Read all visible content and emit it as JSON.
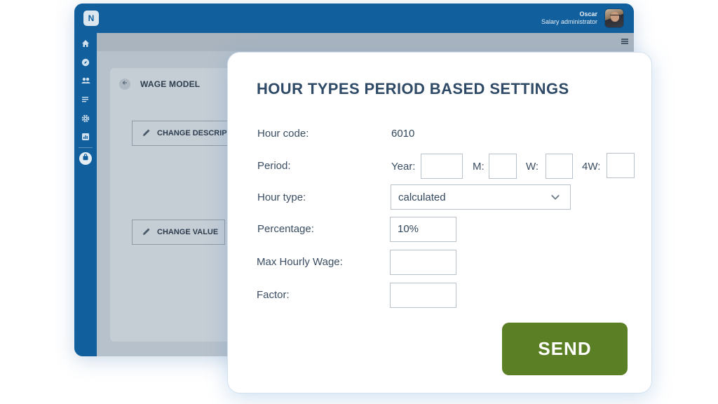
{
  "app": {
    "logo_text": "N",
    "user": {
      "name": "Oscar",
      "role": "Salary administrator"
    },
    "sidebar_icons": [
      "home-icon",
      "compass-icon",
      "users-icon",
      "list-icon",
      "gear-icon",
      "chart-icon",
      "bag-icon"
    ]
  },
  "background_page": {
    "title": "WAGE MODEL",
    "change_description_label": "CHANGE DESCRIPT",
    "change_value_label": "CHANGE VALUE"
  },
  "dialog": {
    "title": "HOUR TYPES PERIOD BASED SETTINGS",
    "hour_code_label": "Hour code:",
    "hour_code_value": "6010",
    "period_label": "Period:",
    "year_label": "Year:",
    "year_value": "",
    "m_label": "M:",
    "m_value": "",
    "w_label": "W:",
    "w_value": "",
    "fourw_label": "4W:",
    "fourw_value": "",
    "hour_type_label": "Hour type:",
    "hour_type_value": "calculated",
    "percentage_label": "Percentage:",
    "percentage_value": "10%",
    "max_hourly_wage_label": "Max Hourly Wage:",
    "max_hourly_wage_value": "",
    "factor_label": "Factor:",
    "factor_value": "",
    "send_label": "SEND"
  },
  "colors": {
    "brand_blue": "#115f9d",
    "send_green": "#5b7f25",
    "title_navy": "#2f4a66"
  }
}
